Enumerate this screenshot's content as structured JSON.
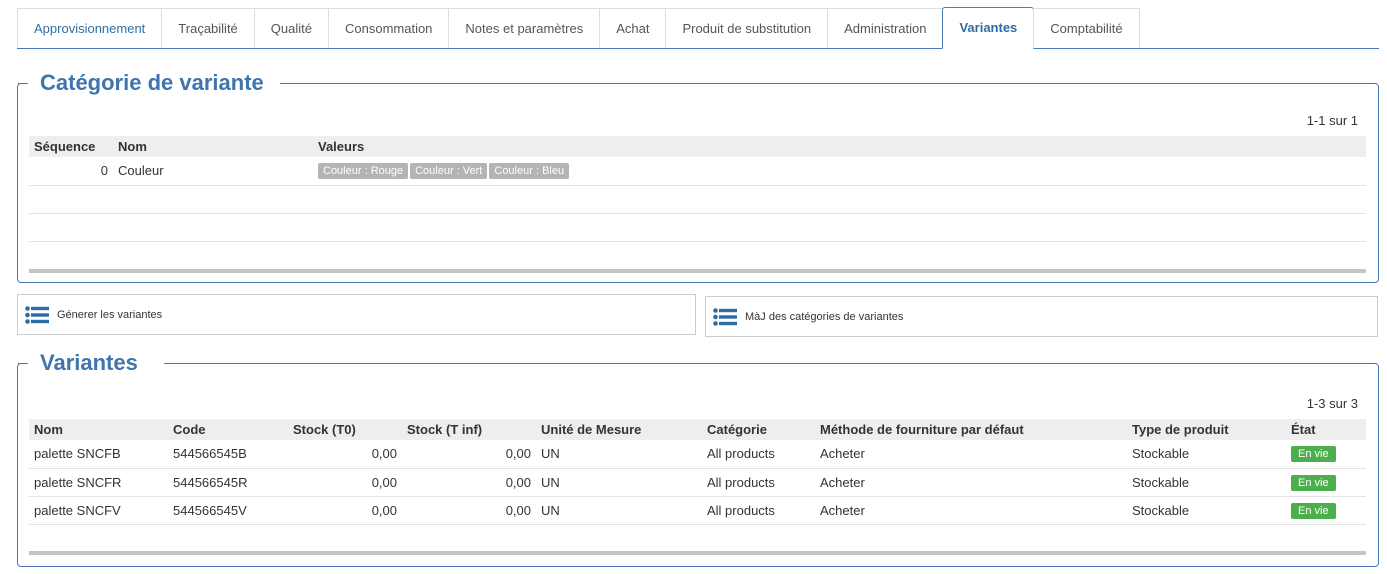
{
  "tabs": [
    {
      "label": "Approvisionnement"
    },
    {
      "label": "Traçabilité"
    },
    {
      "label": "Qualité"
    },
    {
      "label": "Consommation"
    },
    {
      "label": "Notes et paramètres"
    },
    {
      "label": "Achat"
    },
    {
      "label": "Produit de substitution"
    },
    {
      "label": "Administration"
    },
    {
      "label": "Variantes"
    },
    {
      "label": "Comptabilité"
    }
  ],
  "active_tab": "Variantes",
  "categories": {
    "title": "Catégorie de variante",
    "pager": "1-1 sur 1",
    "columns": [
      "Séquence",
      "Nom",
      "Valeurs"
    ],
    "rows": [
      {
        "sequence": "0",
        "name": "Couleur",
        "values": [
          "Couleur : Rouge",
          "Couleur : Vert",
          "Couleur : Bleu"
        ]
      }
    ]
  },
  "actions": {
    "generate_label": "Génerer les variantes",
    "update_label": "MàJ des catégories de variantes",
    "icon": "list-icon"
  },
  "variants": {
    "title": "Variantes",
    "pager": "1-3 sur 3",
    "columns": [
      "Nom",
      "Code",
      "Stock (T0)",
      "Stock (T inf)",
      "Unité de Mesure",
      "Catégorie",
      "Méthode de fourniture par défaut",
      "Type de produit",
      "État"
    ],
    "rows": [
      {
        "name": "palette SNCFB",
        "code": "544566545B",
        "stock_t0": "0,00",
        "stock_tinf": "0,00",
        "uom": "UN",
        "category": "All products",
        "method": "Acheter",
        "type": "Stockable",
        "state": "En vie"
      },
      {
        "name": "palette SNCFR",
        "code": "544566545R",
        "stock_t0": "0,00",
        "stock_tinf": "0,00",
        "uom": "UN",
        "category": "All products",
        "method": "Acheter",
        "type": "Stockable",
        "state": "En vie"
      },
      {
        "name": "palette SNCFV",
        "code": "544566545V",
        "stock_t0": "0,00",
        "stock_tinf": "0,00",
        "uom": "UN",
        "category": "All products",
        "method": "Acheter",
        "type": "Stockable",
        "state": "En vie"
      }
    ]
  },
  "colors": {
    "accent": "#3f74ad",
    "badge_green": "#4cae4c",
    "chip_gray": "#b4b4b4"
  }
}
